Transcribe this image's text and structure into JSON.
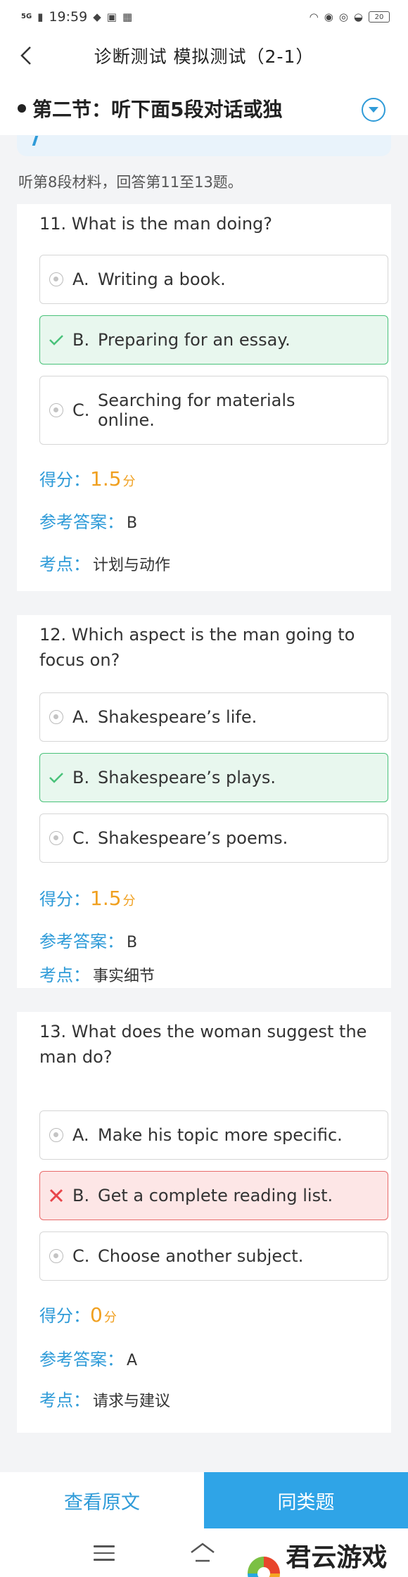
{
  "status_bar": {
    "signal": "5G",
    "time": "19:59",
    "battery": "20"
  },
  "nav": {
    "title": "诊断测试 模拟测试（2-1）"
  },
  "section": {
    "title": "第二节：听下面5段对话或独"
  },
  "instruction": "听第8段材料，回答第11至13题。",
  "labels": {
    "score": "得分：",
    "answer": "参考答案：",
    "point": "考点：",
    "unit": "分"
  },
  "questions": [
    {
      "title": "11. What is the man doing?",
      "options": [
        {
          "letter": "A.",
          "text": "Writing a book.",
          "state": "normal"
        },
        {
          "letter": "B.",
          "text": "Preparing for an essay.",
          "state": "correct"
        },
        {
          "letter": "C.",
          "text": "Searching for materials online.",
          "state": "normal"
        }
      ],
      "score": "1.5",
      "answer": "B",
      "point": "计划与动作"
    },
    {
      "title": "12. Which aspect is the man going to focus on?",
      "options": [
        {
          "letter": "A.",
          "text": "Shakespeare’s life.",
          "state": "normal"
        },
        {
          "letter": "B.",
          "text": "Shakespeare’s plays.",
          "state": "correct"
        },
        {
          "letter": "C.",
          "text": "Shakespeare’s poems.",
          "state": "normal"
        }
      ],
      "score": "1.5",
      "answer": "B",
      "point": "事实细节"
    },
    {
      "title": "13. What does the woman suggest the man do?",
      "options": [
        {
          "letter": "A.",
          "text": "Make his topic more specific.",
          "state": "normal"
        },
        {
          "letter": "B.",
          "text": "Get a complete reading list.",
          "state": "wrong"
        },
        {
          "letter": "C.",
          "text": "Choose another subject.",
          "state": "normal"
        }
      ],
      "score": "0",
      "answer": "A",
      "point": "请求与建议"
    }
  ],
  "bottom": {
    "original_label": "查看原文",
    "similar_label": "同类题"
  },
  "watermark": {
    "text": "君云游戏网"
  },
  "colors": {
    "accent": "#2f9bd8",
    "score": "#f0a020",
    "correct_bg": "#e8f7ee",
    "correct_border": "#49c27a",
    "wrong_bg": "#fde6e6",
    "wrong_border": "#e86a6a"
  },
  "icons": {
    "back": "chevron-left-icon",
    "expand": "chevron-down-circle-icon",
    "correct": "check-icon",
    "wrong": "cross-icon",
    "radio": "radio-icon"
  }
}
